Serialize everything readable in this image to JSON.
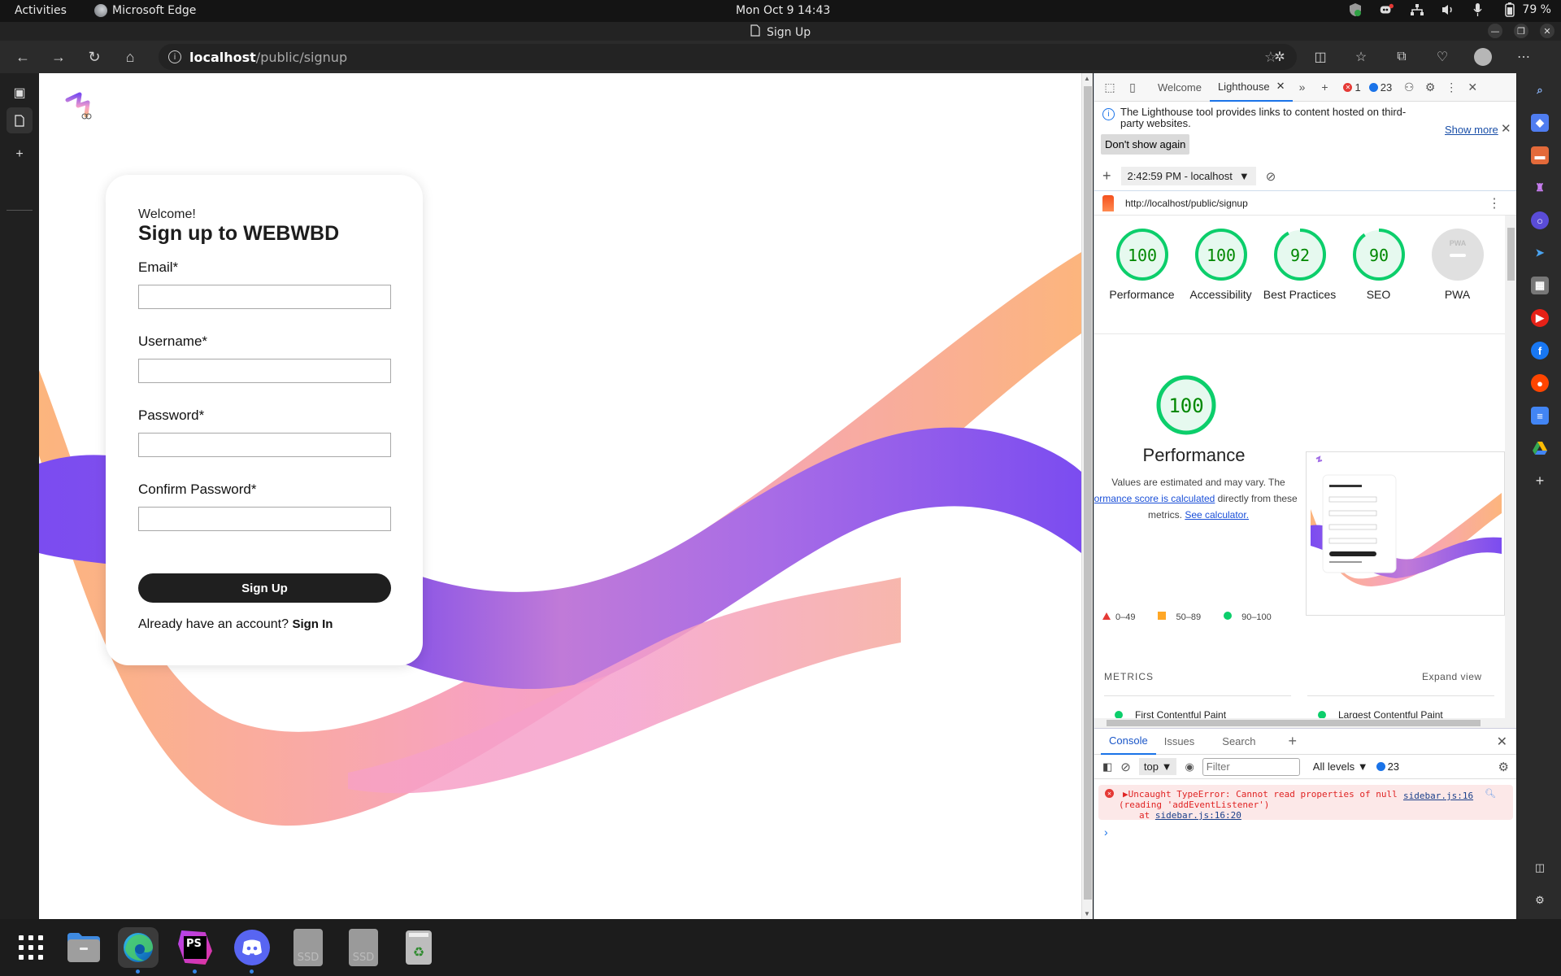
{
  "system": {
    "activities": "Activities",
    "app_name": "Microsoft Edge",
    "clock": "Mon Oct 9  14:43",
    "battery": "79 %"
  },
  "window": {
    "title": "Sign Up"
  },
  "browser": {
    "url_host": "localhost",
    "url_path": "/public/signup"
  },
  "page": {
    "welcome": "Welcome!",
    "heading": "Sign up to WEBWBD",
    "fields": [
      {
        "label": "Email*",
        "value": ""
      },
      {
        "label": "Username*",
        "value": ""
      },
      {
        "label": "Password*",
        "value": ""
      },
      {
        "label": "Confirm Password*",
        "value": ""
      }
    ],
    "submit_label": "Sign Up",
    "already_text": "Already have an account?",
    "signin_label": "Sign In",
    "colors": {
      "wave_orange": "#fcb57d",
      "wave_purple": "#7b4cf0",
      "wave_pink": "#f59fcc"
    }
  },
  "devtools": {
    "tabs": [
      {
        "label": "Welcome",
        "active": false
      },
      {
        "label": "Lighthouse",
        "active": true
      }
    ],
    "error_count": "1",
    "message_count": "23",
    "info_message": "The Lighthouse tool provides links to content hosted on third-party websites.",
    "show_more": "Show more",
    "dont_show_again": "Don't show again",
    "report_select": "2:42:59 PM - localhost",
    "report_url": "http://localhost/public/signup",
    "scores": [
      {
        "label": "Performance",
        "score": 100
      },
      {
        "label": "Accessibility",
        "score": 100
      },
      {
        "label": "Best Practices",
        "score": 92
      },
      {
        "label": "SEO",
        "score": 90
      },
      {
        "label": "PWA",
        "score": null
      }
    ],
    "perf_score": "100",
    "perf_title": "Performance",
    "perf_desc_1": "Values are estimated and may vary. The",
    "perf_desc_link1": "rformance score is calculated",
    "perf_desc_2": " directly from these",
    "perf_desc_3": "metrics. ",
    "perf_desc_link2": "See calculator.",
    "legend": [
      "0–49",
      "50–89",
      "90–100"
    ],
    "metrics_heading": "METRICS",
    "expand_view": "Expand view",
    "metrics": [
      "First Contentful Paint",
      "Largest Contentful Paint"
    ],
    "pwa_label": "PWA",
    "colors": {
      "pass": "#0cce6b",
      "average": "#ffa400",
      "fail": "#ff4e42",
      "pass_text": "#008800"
    }
  },
  "console": {
    "tabs": [
      "Console",
      "Issues",
      "Search"
    ],
    "context": "top",
    "filter_placeholder": "Filter",
    "levels": "All levels",
    "message_count": "23",
    "error_line1": "Uncaught TypeError: Cannot read properties of null",
    "error_line2": "(reading 'addEventListener')",
    "error_at": "at ",
    "error_loc": "sidebar.js:16:20",
    "error_source": "sidebar.js:16"
  },
  "taskbar": {
    "apps": [
      "show-apps",
      "files",
      "microsoft-edge",
      "phpstorm",
      "discord",
      "ssd-drive-1",
      "ssd-drive-2",
      "trash"
    ],
    "ssd_label": "SSD",
    "ps_label": "PS"
  }
}
